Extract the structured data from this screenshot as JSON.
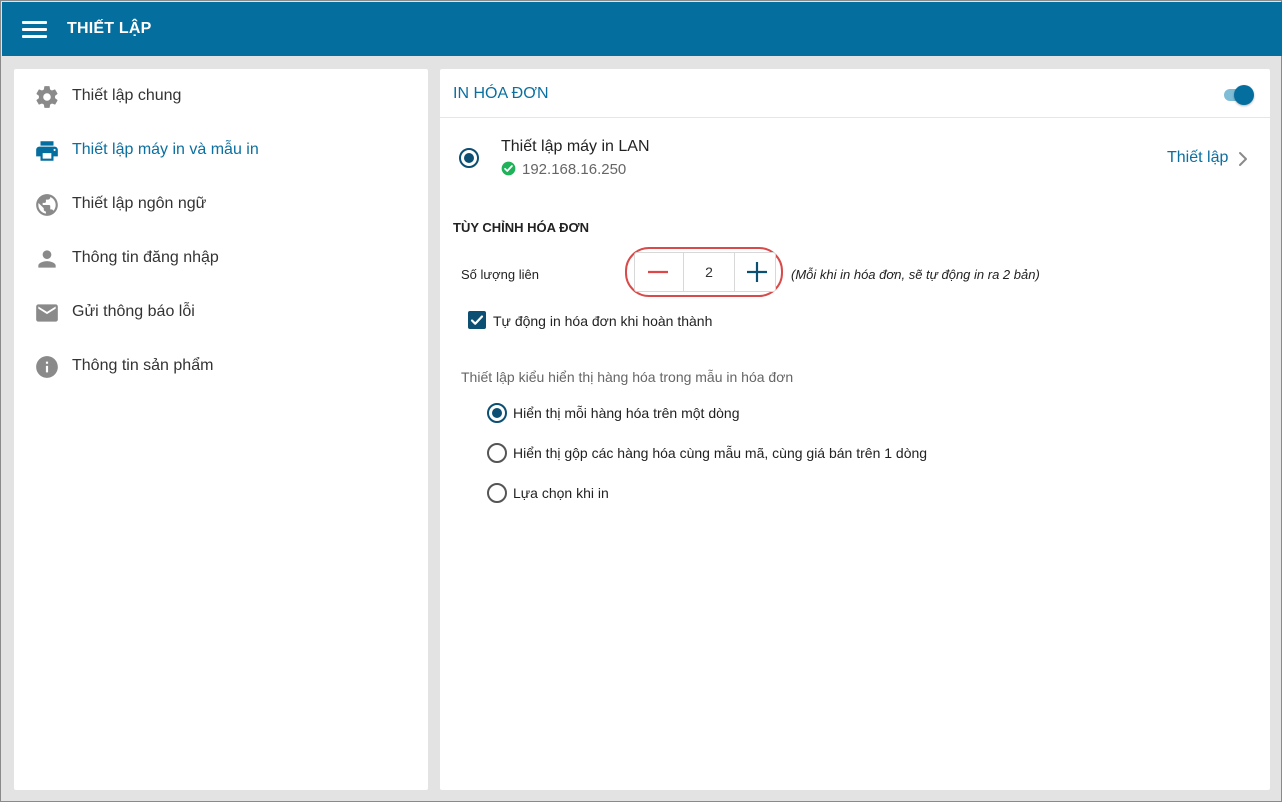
{
  "header": {
    "title": "THIẾT LẬP",
    "menu_icon": "hamburger-menu-icon",
    "bar_color": "#046e9f"
  },
  "sidebar": {
    "items": [
      {
        "label": "Thiết lập chung",
        "icon": "gear-icon",
        "active": false
      },
      {
        "label": "Thiết lập máy in và mẫu in",
        "icon": "printer-icon",
        "active": true
      },
      {
        "label": "Thiết lập ngôn ngữ",
        "icon": "globe-icon",
        "active": false
      },
      {
        "label": "Thông tin đăng nhập",
        "icon": "person-icon",
        "active": false
      },
      {
        "label": "Gửi thông báo lỗi",
        "icon": "mail-icon",
        "active": false
      },
      {
        "label": "Thông tin sản phẩm",
        "icon": "info-icon",
        "active": false
      }
    ],
    "active_color": "#0b6fa0"
  },
  "panel": {
    "title": "IN HÓA ĐƠN",
    "toggle_on": true,
    "printer": {
      "name": "Thiết lập máy in LAN",
      "ip": "192.168.16.250",
      "status_icon": "check-circle-icon",
      "selected": true,
      "setup_label": "Thiết lập"
    },
    "customize": {
      "title": "TÙY CHỈNH HÓA ĐƠN",
      "copies_label": "Số lượng liên",
      "copies_value": "2",
      "copies_note": "(Mỗi khi in hóa đơn, sẽ tự động in ra 2 bản)",
      "auto_print_label": "Tự động in hóa đơn khi hoàn thành",
      "auto_print_checked": true
    },
    "display": {
      "title": "Thiết lập kiểu hiển thị hàng hóa trong mẫu in hóa đơn",
      "options": [
        {
          "label": "Hiển thị mỗi hàng hóa trên một dòng",
          "selected": true
        },
        {
          "label": "Hiển thị gộp các hàng hóa cùng mẫu mã, cùng giá bán trên 1 dòng",
          "selected": false
        },
        {
          "label": "Lựa chọn khi in",
          "selected": false
        }
      ]
    }
  }
}
